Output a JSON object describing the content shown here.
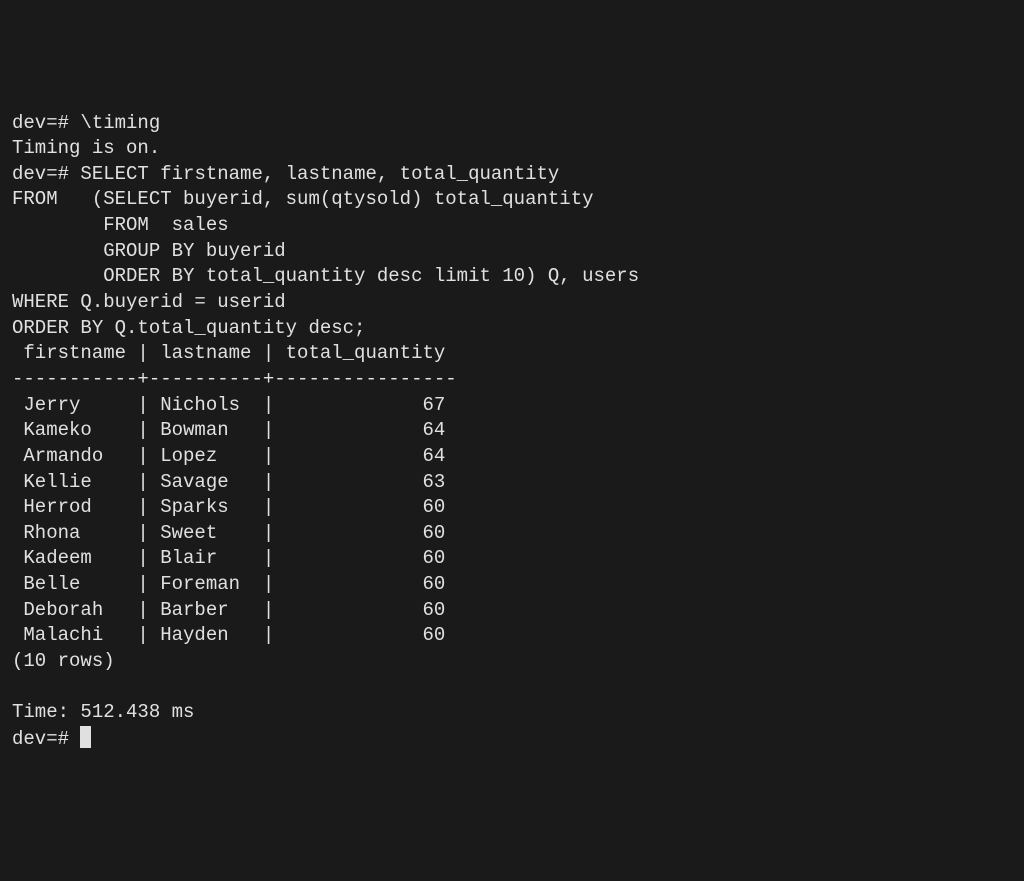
{
  "prompt": "dev=#",
  "timing_cmd": "\\timing",
  "timing_msg": "Timing is on.",
  "query_lines": [
    "SELECT firstname, lastname, total_quantity",
    "FROM   (SELECT buyerid, sum(qtysold) total_quantity",
    "        FROM  sales",
    "        GROUP BY buyerid",
    "        ORDER BY total_quantity desc limit 10) Q, users",
    "WHERE Q.buyerid = userid",
    "ORDER BY Q.total_quantity desc;"
  ],
  "table": {
    "header": " firstname | lastname | total_quantity",
    "separator": "-----------+----------+----------------",
    "rows": [
      {
        "firstname": "Jerry",
        "lastname": "Nichols",
        "total_quantity": 67
      },
      {
        "firstname": "Kameko",
        "lastname": "Bowman",
        "total_quantity": 64
      },
      {
        "firstname": "Armando",
        "lastname": "Lopez",
        "total_quantity": 64
      },
      {
        "firstname": "Kellie",
        "lastname": "Savage",
        "total_quantity": 63
      },
      {
        "firstname": "Herrod",
        "lastname": "Sparks",
        "total_quantity": 60
      },
      {
        "firstname": "Rhona",
        "lastname": "Sweet",
        "total_quantity": 60
      },
      {
        "firstname": "Kadeem",
        "lastname": "Blair",
        "total_quantity": 60
      },
      {
        "firstname": "Belle",
        "lastname": "Foreman",
        "total_quantity": 60
      },
      {
        "firstname": "Deborah",
        "lastname": "Barber",
        "total_quantity": 60
      },
      {
        "firstname": "Malachi",
        "lastname": "Hayden",
        "total_quantity": 60
      }
    ],
    "row_count_msg": "(10 rows)"
  },
  "timing_result_label": "Time:",
  "timing_result_value": "512.438 ms"
}
